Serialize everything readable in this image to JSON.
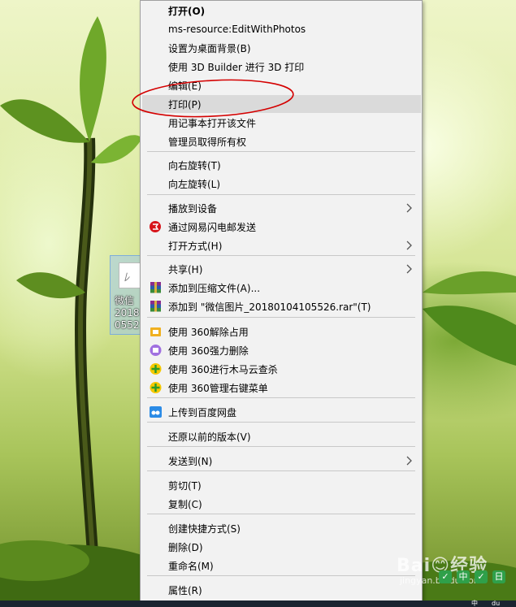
{
  "desktop": {
    "file_label": "微信\n2018\n0552"
  },
  "menu": {
    "items": [
      {
        "label": "打开(O)",
        "bold": true
      },
      {
        "label": "ms-resource:EditWithPhotos"
      },
      {
        "label": "设置为桌面背景(B)"
      },
      {
        "label": "使用 3D Builder 进行 3D 打印"
      },
      {
        "label": "编辑(E)"
      },
      {
        "label": "打印(P)",
        "highlighted": true
      },
      {
        "label": "用记事本打开该文件"
      },
      {
        "label": "管理员取得所有权"
      },
      {
        "label": "向右旋转(T)"
      },
      {
        "label": "向左旋转(L)"
      },
      {
        "label": "播放到设备",
        "submenu": true
      },
      {
        "label": "通过网易闪电邮发送",
        "icon": "netease-mail-icon"
      },
      {
        "label": "打开方式(H)",
        "submenu": true
      },
      {
        "label": "共享(H)",
        "submenu": true
      },
      {
        "label": "添加到压缩文件(A)...",
        "icon": "winrar-icon"
      },
      {
        "label": "添加到 \"微信图片_20180104105526.rar\"(T)",
        "icon": "winrar-icon"
      },
      {
        "label": "使用 360解除占用",
        "icon": "360-unlock-icon"
      },
      {
        "label": "使用 360强力删除",
        "icon": "360-shred-icon"
      },
      {
        "label": "使用 360进行木马云查杀",
        "icon": "360-scan-icon"
      },
      {
        "label": "使用 360管理右键菜单",
        "icon": "360-scan-icon"
      },
      {
        "label": "上传到百度网盘",
        "icon": "baidu-netdisk-icon"
      },
      {
        "label": "还原以前的版本(V)"
      },
      {
        "label": "发送到(N)",
        "submenu": true
      },
      {
        "label": "剪切(T)"
      },
      {
        "label": "复制(C)"
      },
      {
        "label": "创建快捷方式(S)"
      },
      {
        "label": "删除(D)"
      },
      {
        "label": "重命名(M)"
      },
      {
        "label": "属性(R)"
      }
    ]
  },
  "annotation": {
    "color": "#d40000"
  },
  "watermark": {
    "line1": "Bai😊经验",
    "line2": "jingyan.baidu.com"
  },
  "taskbar": {
    "ime": "中",
    "tray_text": "du"
  },
  "mini_tools": [
    "✓",
    "中",
    "✓",
    "日"
  ]
}
